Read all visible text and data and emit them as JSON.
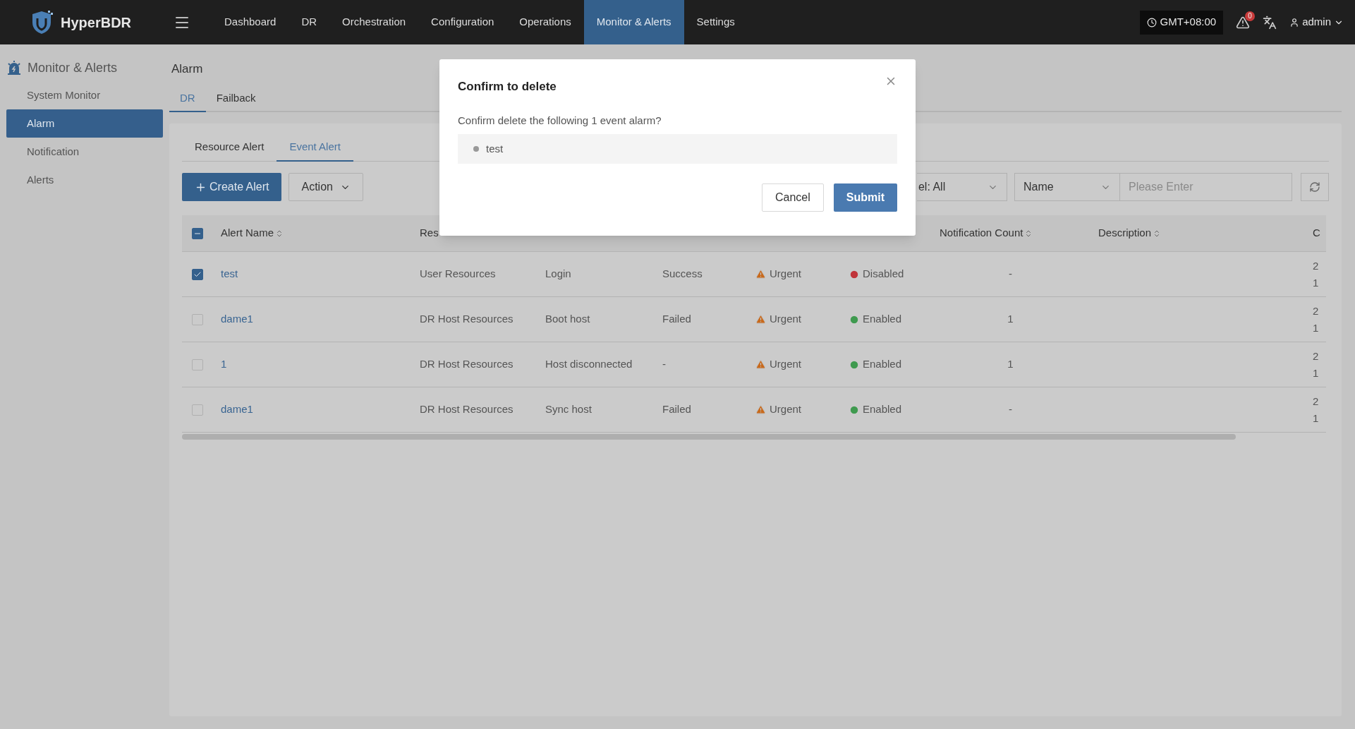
{
  "topbar": {
    "brand": "HyperBDR",
    "nav": [
      {
        "label": "Dashboard",
        "selected": false
      },
      {
        "label": "DR",
        "selected": false
      },
      {
        "label": "Orchestration",
        "selected": false
      },
      {
        "label": "Configuration",
        "selected": false
      },
      {
        "label": "Operations",
        "selected": false
      },
      {
        "label": "Monitor & Alerts",
        "selected": true
      },
      {
        "label": "Settings",
        "selected": false
      }
    ],
    "timezone": "GMT+08:00",
    "notification_count": "0",
    "user": "admin"
  },
  "sidebar": {
    "title": "Monitor & Alerts",
    "items": [
      {
        "label": "System Monitor",
        "selected": false
      },
      {
        "label": "Alarm",
        "selected": true
      },
      {
        "label": "Notification",
        "selected": false
      },
      {
        "label": "Alerts",
        "selected": false
      }
    ]
  },
  "page": {
    "title": "Alarm",
    "tabs": [
      {
        "label": "DR",
        "selected": true
      },
      {
        "label": "Failback",
        "selected": false
      }
    ],
    "subtabs": [
      {
        "label": "Resource Alert",
        "selected": false
      },
      {
        "label": "Event Alert",
        "selected": true
      }
    ],
    "toolbar": {
      "create_button": "Create Alert",
      "action_button": "Action",
      "level_filter": "el: All",
      "field_select": "Name",
      "search": {
        "placeholder": "Please Enter"
      }
    }
  },
  "table": {
    "header_checkbox_indeterminate": true,
    "columns": [
      {
        "label": "Alert Name",
        "sortable": true
      },
      {
        "label": "Res",
        "sortable": false
      },
      {
        "label": "Notification Count",
        "sortable": true
      },
      {
        "label": "Description",
        "sortable": true
      },
      {
        "label": "C",
        "sortable": false
      }
    ],
    "rows": [
      {
        "selected": true,
        "alert_name": "test",
        "resource_type": "User Resources",
        "event_type": "Login",
        "result": "Success",
        "level": "Urgent",
        "status": {
          "label": "Disabled",
          "enabled": false
        },
        "notification_count": "-",
        "column_9": [
          "2",
          "1"
        ]
      },
      {
        "selected": false,
        "alert_name": "dame1",
        "resource_type": "DR Host Resources",
        "event_type": "Boot host",
        "result": "Failed",
        "level": "Urgent",
        "status": {
          "label": "Enabled",
          "enabled": true
        },
        "notification_count": "1",
        "column_9": [
          "2",
          "1"
        ]
      },
      {
        "selected": false,
        "alert_name": "1",
        "resource_type": "DR Host Resources",
        "event_type": "Host disconnected",
        "result": "-",
        "level": "Urgent",
        "status": {
          "label": "Enabled",
          "enabled": true
        },
        "notification_count": "1",
        "column_9": [
          "2",
          "1"
        ]
      },
      {
        "selected": false,
        "alert_name": "dame1",
        "resource_type": "DR Host Resources",
        "event_type": "Sync host",
        "result": "Failed",
        "level": "Urgent",
        "status": {
          "label": "Enabled",
          "enabled": true
        },
        "notification_count": "-",
        "column_9": [
          "2",
          "1"
        ]
      }
    ]
  },
  "modal": {
    "title": "Confirm to delete",
    "message": "Confirm delete the following 1 event alarm?",
    "items": [
      "test"
    ],
    "cancel_button": "Cancel",
    "submit_button": "Submit"
  }
}
